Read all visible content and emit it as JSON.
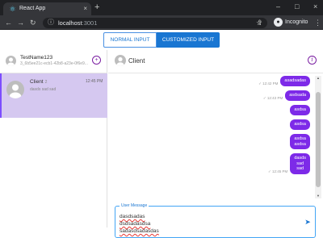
{
  "browser": {
    "tab_title": "React App",
    "close_glyph": "×",
    "new_tab_glyph": "+",
    "window_minimize": "–",
    "window_maximize": "□",
    "window_close": "×",
    "url_host": "localhost",
    "url_port": ":3001",
    "profile_label": "Incognito",
    "icons": [
      "react-icon",
      "back-icon",
      "forward-icon",
      "reload-icon",
      "info-icon",
      "share-icon",
      "star-icon",
      "incognito-icon",
      "menu-kebab-icon"
    ]
  },
  "toggle": {
    "normal_label": "NORMAL INPUT",
    "custom_label": "CUSTOMIZED INPUT"
  },
  "sidebar": {
    "user_name": "TestName123",
    "user_id": "3_6b5ee21c-ecb1-42b8-a23e-0f6e9...",
    "new_chat_glyph": "+",
    "chats": [
      {
        "name": "Client",
        "badge": "2",
        "time": "12:45 PM",
        "preview": "dasds sad sad"
      }
    ]
  },
  "main": {
    "contact_name": "Client",
    "info_glyph": "i",
    "messages": [
      {
        "meta": "✓ 12:42 PM",
        "text": "asadsadas"
      },
      {
        "meta": "✓ 12:43 PM",
        "text": "asdsada"
      },
      {
        "meta": "",
        "text": "asdsa"
      },
      {
        "meta": "",
        "text": "asdsa"
      },
      {
        "meta": "",
        "text": "asdsa\nasdsa"
      },
      {
        "meta": "✓ 12:45 PM",
        "text": "dasds\nsad\nsad"
      }
    ]
  },
  "composer": {
    "label": "User Message",
    "value": "dasdsadas\ndsdsadasdsa\nsadasdsadasdas"
  },
  "colors": {
    "accent_purple": "#7d2ae8",
    "selected_chat_bg": "#d5c8f0",
    "primary_blue": "#1976d2"
  }
}
